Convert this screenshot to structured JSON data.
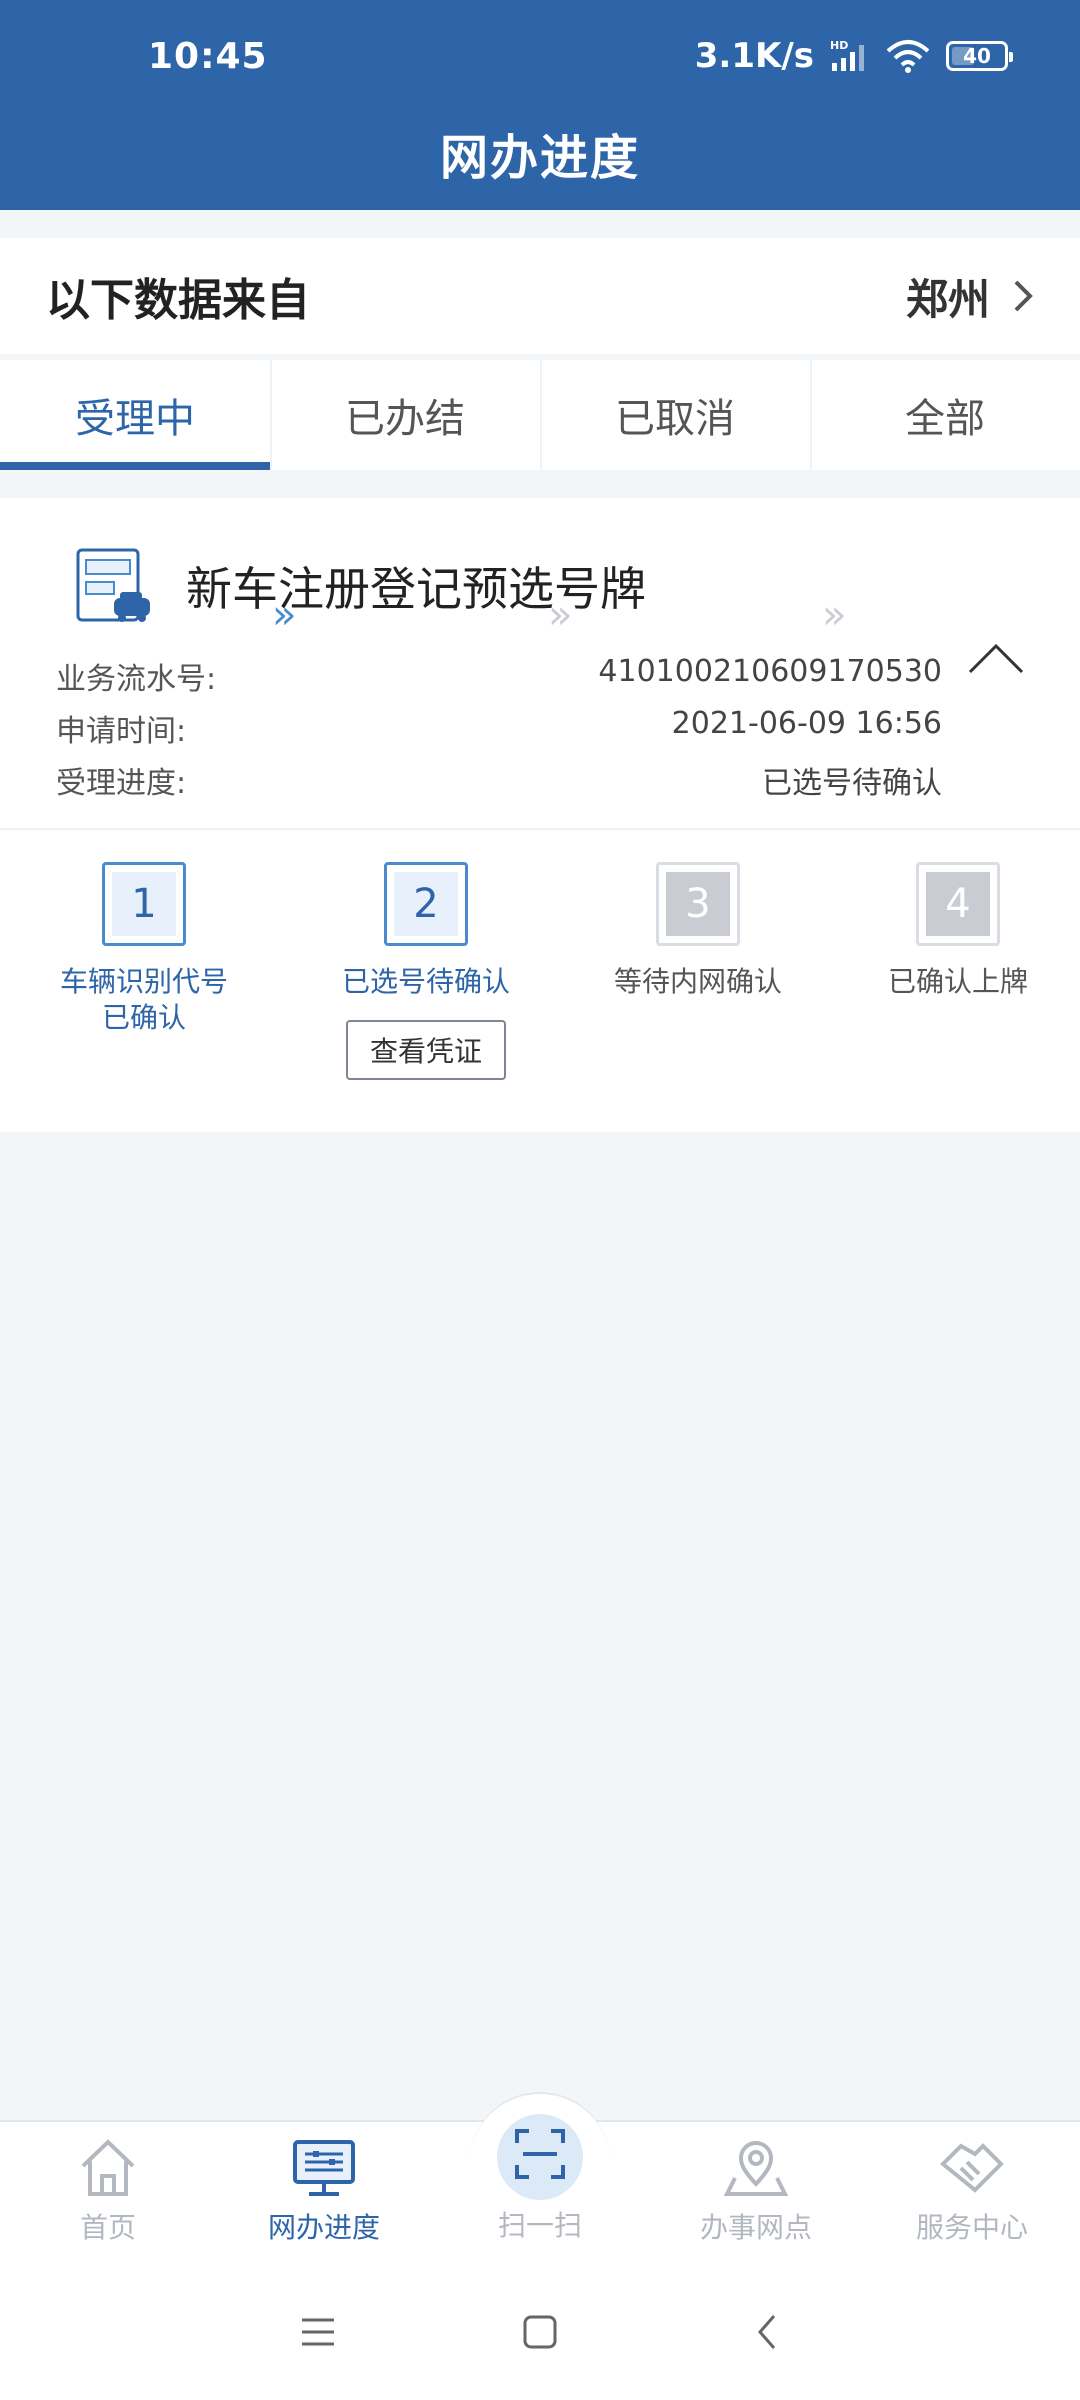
{
  "status_bar": {
    "time": "10:45",
    "network_speed": "3.1K/s",
    "network_badge": "HD",
    "battery": "40"
  },
  "header": {
    "title": "网办进度"
  },
  "source": {
    "label": "以下数据来自",
    "city": "郑州"
  },
  "tabs": [
    {
      "label": "受理中",
      "active": true
    },
    {
      "label": "已办结"
    },
    {
      "label": "已取消"
    },
    {
      "label": "全部"
    }
  ],
  "card": {
    "title": "新车注册登记预选号牌",
    "fields": [
      {
        "label": "业务流水号:",
        "value": "410100210609170530"
      },
      {
        "label": "申请时间:",
        "value": "2021-06-09 16:56"
      },
      {
        "label": "受理进度:",
        "value": "已选号待确认"
      }
    ],
    "steps": [
      {
        "number": "1",
        "label": "车辆识别代号\n已确认",
        "state": "done"
      },
      {
        "number": "2",
        "label": "已选号待确认",
        "state": "current"
      },
      {
        "number": "3",
        "label": "等待内网确认",
        "state": "pending"
      },
      {
        "number": "4",
        "label": "已确认上牌",
        "state": "pending"
      }
    ],
    "voucher_button": "查看凭证",
    "arrow_glyph": "»"
  },
  "bottom_nav": [
    {
      "label": "首页",
      "icon": "home-icon"
    },
    {
      "label": "网办进度",
      "icon": "monitor-icon",
      "active": true
    },
    {
      "label": "扫一扫",
      "icon": "scan-icon"
    },
    {
      "label": "办事网点",
      "icon": "location-icon"
    },
    {
      "label": "服务中心",
      "icon": "handshake-icon"
    }
  ],
  "colors": {
    "primary": "#2d65a8",
    "step_active": "#4a8bd0",
    "step_inactive": "#c9ccd3",
    "background": "#f3f6f9"
  }
}
